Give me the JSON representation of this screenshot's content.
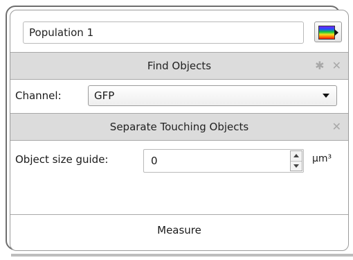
{
  "population": {
    "name": "Population 1"
  },
  "color_button": {
    "icon": "color-palette-icon"
  },
  "find_objects": {
    "title": "Find Objects",
    "settings_icon": "gear-icon",
    "close_icon": "close-icon",
    "channel_label": "Channel:",
    "channel_value": "GFP"
  },
  "separate": {
    "title": "Separate Touching Objects",
    "close_icon": "close-icon",
    "size_label": "Object size guide:",
    "size_value": "0",
    "unit": "µm³"
  },
  "measure": {
    "title": "Measure"
  },
  "icons": {
    "gear": "✱",
    "close": "✕"
  }
}
